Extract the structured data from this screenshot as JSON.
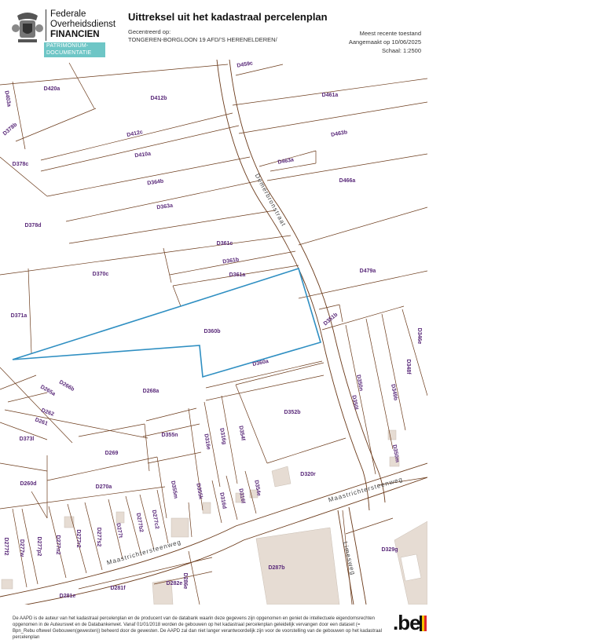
{
  "header": {
    "agency_line1": "Federale",
    "agency_line2": "Overheidsdienst",
    "agency_line3": "FINANCIEN",
    "badge_line1": "PATRIMONIUM-",
    "badge_line2": "DOCUMENTATIE",
    "title": "Uittreksel uit het kadastraal percelenplan",
    "centered_label": "Gecentreerd op:",
    "centered_value": "TONGEREN-BORGLOON 19 AFD/'S HERENELDEREN/",
    "state": "Meest recente toestand",
    "created": "Aangemaakt op 10/06/2025",
    "scale": "Schaal: 1:2500"
  },
  "map": {
    "parcels": [
      "D420a",
      "D403a",
      "D378b",
      "D412b",
      "D461a",
      "D459c",
      "D412c",
      "D463b",
      "D378c",
      "D410a",
      "D463a",
      "D364b",
      "D466a",
      "D363a",
      "D378d",
      "D361c",
      "D361b",
      "D370c",
      "D361a",
      "D479a",
      "D371a",
      "D351b",
      "D346e",
      "D360b",
      "D348f",
      "D360a",
      "D266b",
      "D268a",
      "D350n",
      "D265a",
      "D349b",
      "D350l",
      "D262",
      "D352b",
      "D261",
      "D355n",
      "D316e",
      "D316g",
      "D354f",
      "D373l",
      "D350m",
      "D269",
      "D260d",
      "D320r",
      "D355m",
      "D270a",
      "D355k",
      "D316d",
      "D316f",
      "D354e",
      "D277f2",
      "D277w",
      "D277p2",
      "D277n2",
      "D277r2",
      "D277s2",
      "D277t",
      "D277b2",
      "D277c2",
      "D329g",
      "D287b",
      "D286e",
      "D281f",
      "D282e",
      "D281e"
    ],
    "streets": [
      "Demerbronstraat",
      "Maastrichtersteenweg",
      "Maastrichtersteenweg",
      "Limesweg"
    ]
  },
  "footer": {
    "disclaimer": "De AAPD is de auteur van het kadastraal percelenplan en de producent van de databank waarin deze gegevens zijn opgenomen en geniet de intellectuele eigendomsrechten opgenomen in de Auteurswet en de Databankenwet. Vanaf 01/01/2018 worden de gebouwen op het kadastraal percelenplan geleidelijk vervangen door een dataset (= Bpn_Rebu oftewel Gebouwen(gewesten)) beheerd door de gewesten. De AAPD zal dan niet langer verantwoordelijk zijn voor de voorstelling van de gebouwen op het kadastraal percelenplan",
    "brand": ".be"
  },
  "colors": {
    "parcel_label": "#5a2a7a",
    "selected_outline": "#2f8fc2",
    "badge": "#6ec6c6",
    "building": "#e6dcd3",
    "road": "#ffffff"
  }
}
